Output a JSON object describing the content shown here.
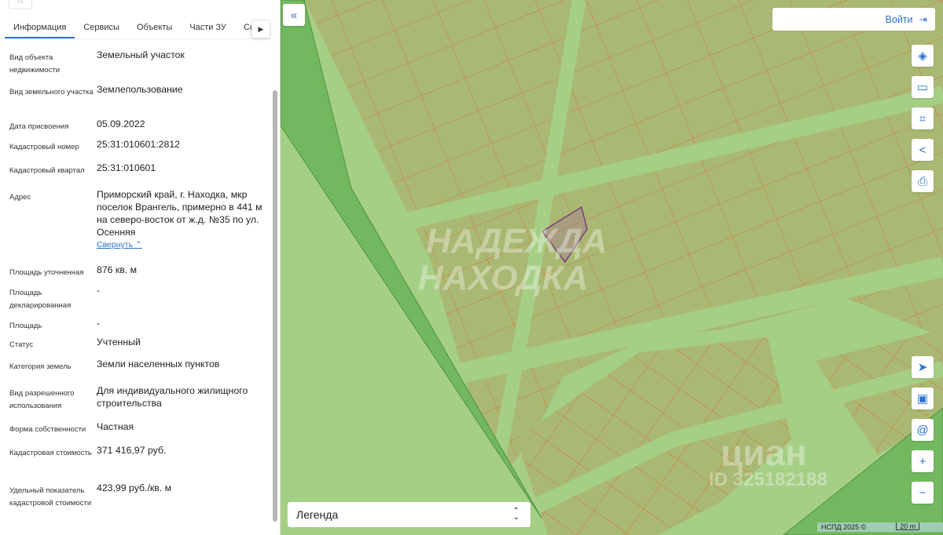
{
  "panel": {
    "tabs": [
      "Информация",
      "Сервисы",
      "Объекты",
      "Части ЗУ",
      "Соста"
    ],
    "rows": [
      {
        "label": "Вид объекта недвижимости",
        "value": "Земельный участок"
      },
      {
        "label": "Вид земельного участка",
        "value": "Землепользование"
      },
      {
        "label": "Дата присвоения",
        "value": "05.09.2022"
      },
      {
        "label": "Кадастровый номер",
        "value": "25:31:010601:2812"
      },
      {
        "label": "Кадастровый квартал",
        "value": "25:31:010601"
      },
      {
        "label": "Адрес",
        "value": "Приморский край, г. Находка, мкр поселок Врангель, примерно в 441 м на северо-восток от ж.д. №35 по ул. Осенняя"
      },
      {
        "label": "Площадь уточненная",
        "value": "876 кв. м"
      },
      {
        "label": "Площадь декларированная",
        "value": "-"
      },
      {
        "label": "Площадь",
        "value": "-"
      },
      {
        "label": "Статус",
        "value": "Учтенный"
      },
      {
        "label": "Категория земель",
        "value": "Земли населенных пунктов"
      },
      {
        "label": "Вид разрешенного использования",
        "value": "Для индивидуального жилищного строительства"
      },
      {
        "label": "Форма собственности",
        "value": "Частная"
      },
      {
        "label": "Кадастровая стоимость",
        "value": "371 416,97 руб."
      },
      {
        "label": "Удельный показатель кадастровой стоимости",
        "value": "423,99 руб./кв. м"
      }
    ],
    "collapse_link": "Свернуть"
  },
  "map": {
    "login_label": "Войти",
    "legend_label": "Легенда",
    "copyright": "НСПД 2025 ©",
    "scale": "20 m",
    "watermark_1": "НАДЕЖДА",
    "watermark_2": "НАХОДКА",
    "watermark_3": "циан",
    "watermark_4": "ID 325182188"
  },
  "colors": {
    "accent": "#2a72c9",
    "parcel_fill": "#a9b872",
    "parcel_line": "#d5743a",
    "green_light": "#a6cf86",
    "green_dark": "#72b85e"
  }
}
